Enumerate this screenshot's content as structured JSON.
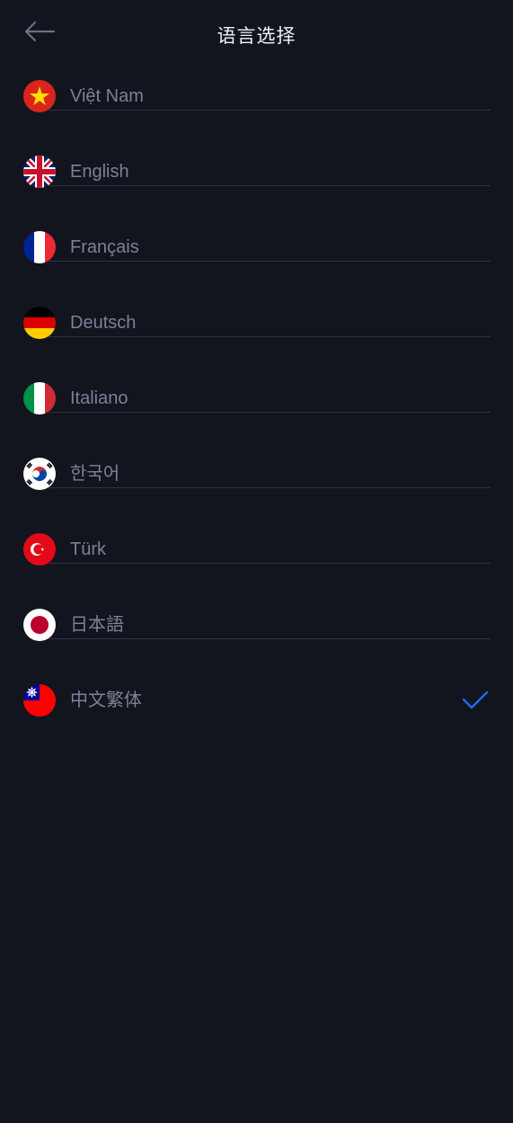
{
  "header": {
    "title": "语言选择",
    "back_icon": "arrow-left-icon"
  },
  "languages": [
    {
      "label": "Việt Nam",
      "flag": "vietnam-flag-icon",
      "selected": false
    },
    {
      "label": "English",
      "flag": "uk-flag-icon",
      "selected": false
    },
    {
      "label": "Français",
      "flag": "france-flag-icon",
      "selected": false
    },
    {
      "label": "Deutsch",
      "flag": "germany-flag-icon",
      "selected": false
    },
    {
      "label": "Italiano",
      "flag": "italy-flag-icon",
      "selected": false
    },
    {
      "label": "한국어",
      "flag": "korea-flag-icon",
      "selected": false
    },
    {
      "label": "Türk",
      "flag": "turkey-flag-icon",
      "selected": false
    },
    {
      "label": "日本語",
      "flag": "japan-flag-icon",
      "selected": false
    },
    {
      "label": "中文繁体",
      "flag": "taiwan-flag-icon",
      "selected": true
    }
  ],
  "colors": {
    "background": "#12141e",
    "title": "#f1f2f5",
    "label": "#7c8196",
    "divider": "#2f3342",
    "check": "#1d6cf3"
  }
}
